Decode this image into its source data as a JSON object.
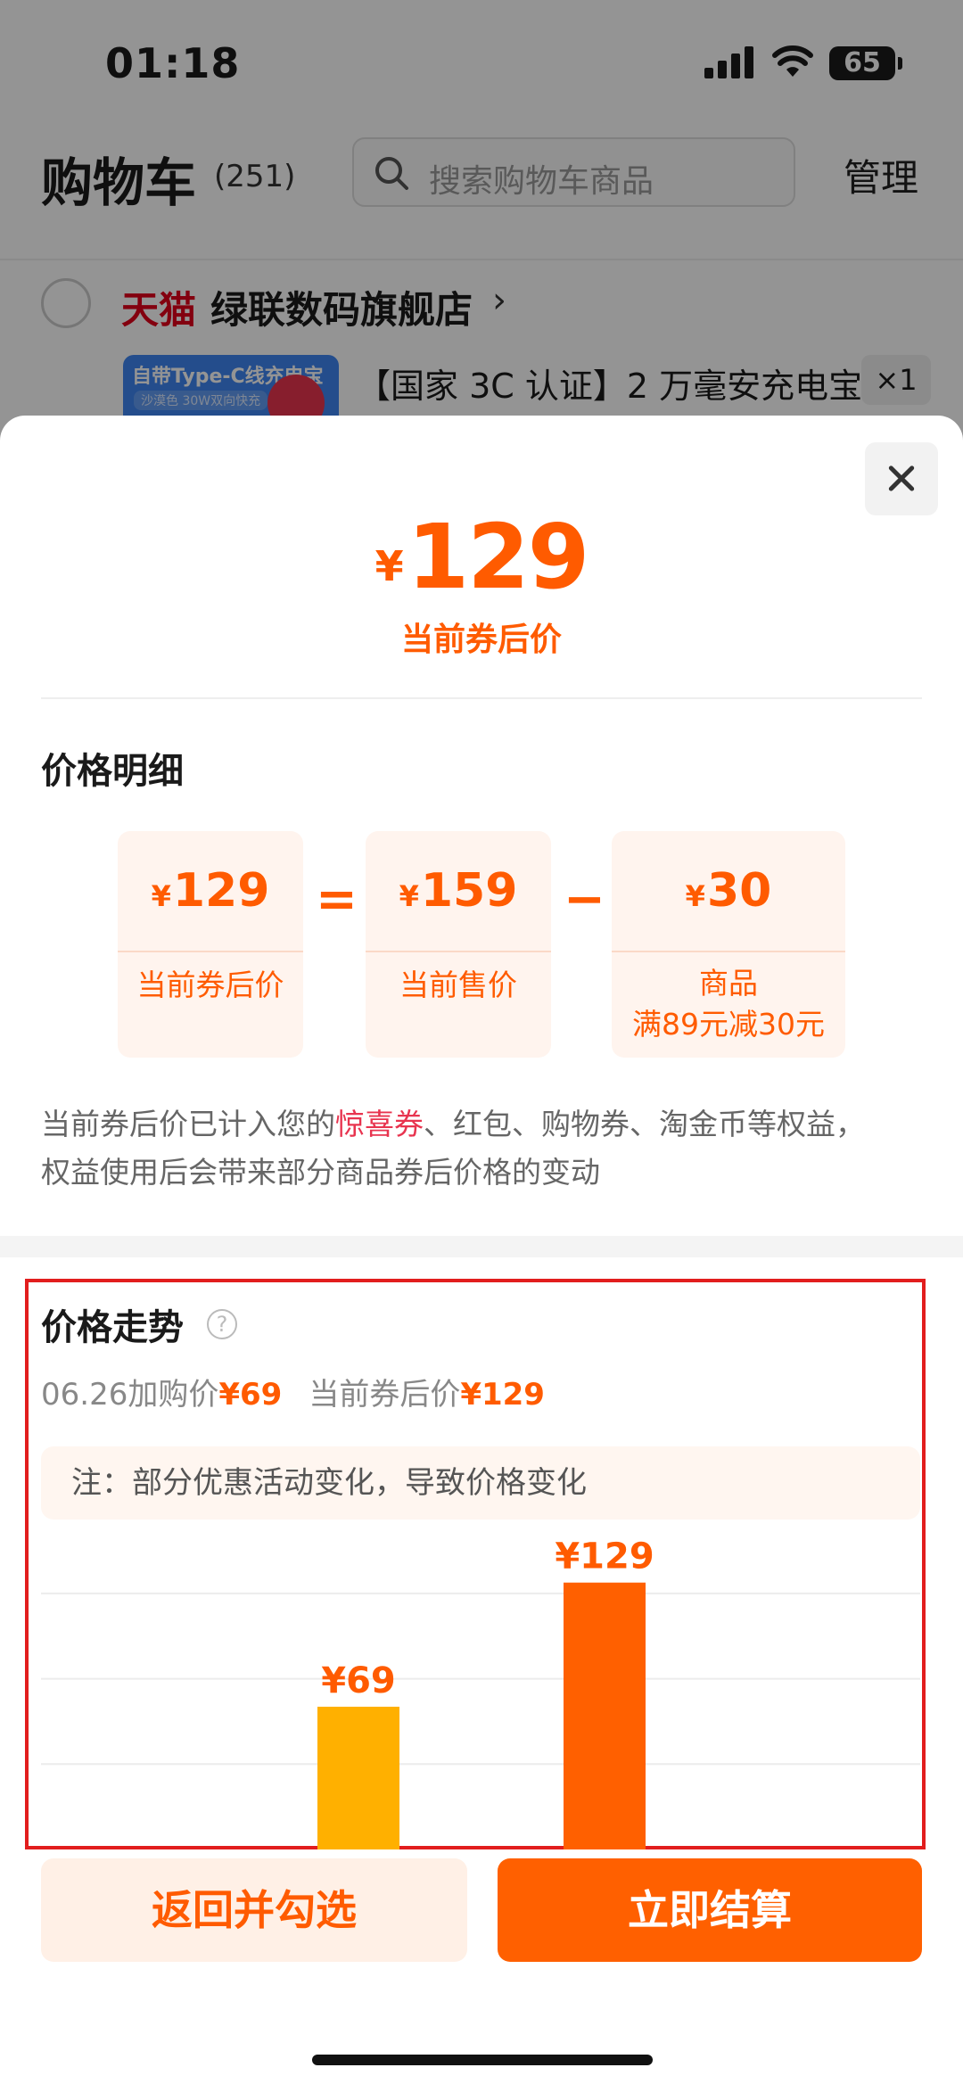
{
  "status_bar": {
    "time": "01:18",
    "battery": "65",
    "icons": [
      "signal-icon",
      "wifi-icon",
      "battery-icon"
    ]
  },
  "cart": {
    "title": "购物车",
    "count": "(251)",
    "search_placeholder": "搜索购物车商品",
    "manage": "管理",
    "shop": {
      "platform": "天猫",
      "name": "绿联数码旗舰店",
      "chevron": "›"
    },
    "item": {
      "thumb_title": "自带Type-C线充电宝",
      "thumb_sub": "沙漠色 30W双向快充",
      "title": "【国家 3C 认证】2 万毫安充电宝",
      "qty": "×1"
    }
  },
  "sheet": {
    "hero": {
      "currency": "¥",
      "price": "129",
      "label": "当前券后价"
    },
    "detail": {
      "title": "价格明细",
      "cards": [
        {
          "currency": "¥",
          "price": "129",
          "label": "当前券后价"
        },
        {
          "currency": "¥",
          "price": "159",
          "label": "当前售价"
        },
        {
          "currency": "¥",
          "price": "30",
          "label_line1": "商品",
          "label_line2": "满89元减30元"
        }
      ],
      "op_equal": "=",
      "op_minus": "−",
      "note_before": "当前券后价已计入您的",
      "note_highlight": "惊喜券",
      "note_after": "、红包、购物券、淘金币等权益，",
      "note_line2": "权益使用后会带来部分商品券后价格的变动"
    },
    "trend": {
      "title": "价格走势",
      "help": "?",
      "summary_1_label": "06.26加购价",
      "summary_1_price": "¥69",
      "summary_2_label": "当前券后价",
      "summary_2_price": "¥129",
      "note": "注：部分优惠活动变化，导致价格变化"
    },
    "buttons": {
      "back": "返回并勾选",
      "pay": "立即结算"
    }
  },
  "colors": {
    "accent": "#ff5b00",
    "bar_old": "#ffb000",
    "bar_new": "#ff6000",
    "highlight": "#e8344f",
    "tmall": "#e2001a"
  },
  "chart_data": {
    "type": "bar",
    "categories": [
      "",
      ""
    ],
    "values": [
      69,
      129
    ],
    "data_labels": [
      "¥69",
      "¥129"
    ],
    "colors": [
      "#ffb000",
      "#ff6000"
    ],
    "ylim": [
      0,
      150
    ],
    "grid": true,
    "title": "",
    "xlabel": "",
    "ylabel": ""
  }
}
